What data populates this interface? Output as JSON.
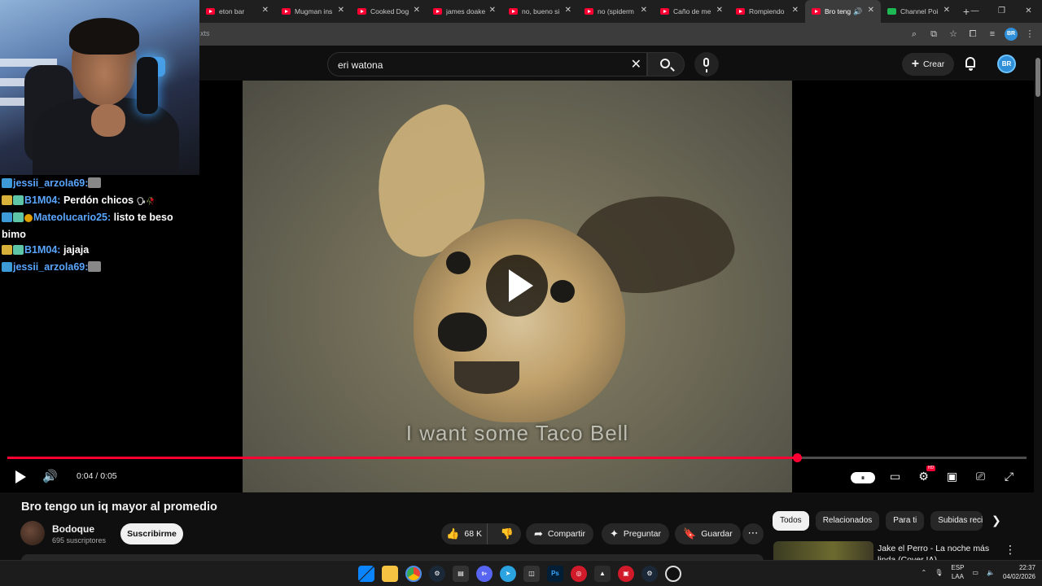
{
  "browser": {
    "tabs": [
      {
        "label": "eton bar",
        "favicon": "youtube-icon",
        "active": false
      },
      {
        "label": "Mugman ins",
        "favicon": "youtube-icon",
        "active": false
      },
      {
        "label": "Cooked Dog",
        "favicon": "youtube-icon",
        "active": false
      },
      {
        "label": "james doake",
        "favicon": "youtube-icon",
        "active": false
      },
      {
        "label": "no, bueno si",
        "favicon": "youtube-icon",
        "active": false
      },
      {
        "label": "no (spiderm",
        "favicon": "youtube-icon",
        "active": false
      },
      {
        "label": "Caño de me",
        "favicon": "youtube-icon",
        "active": false
      },
      {
        "label": "Rompiendo",
        "favicon": "youtube-icon",
        "active": false
      },
      {
        "label": "Bro teng",
        "favicon": "youtube-icon",
        "active": true
      },
      {
        "label": "Channel Poi",
        "favicon": "kick-icon",
        "active": false
      }
    ],
    "new_tab": "+",
    "close_glyph": "✕",
    "address_fragment": "xts",
    "window_controls": [
      "—",
      "❐",
      "✕"
    ],
    "profile_initials": "BR"
  },
  "youtube": {
    "search": {
      "value": "eri watona"
    },
    "create_label": "Crear",
    "avatar_initials": "BR"
  },
  "player": {
    "subtitle": "I want some Taco Bell",
    "time_display": "0:04 / 0:05",
    "progress_fraction": 0.775,
    "autoplay_glyph": "⏸",
    "hd_badge": "HD",
    "accent": "#ff0033"
  },
  "video": {
    "title": "Bro tengo un iq mayor al promedio",
    "channel": "Bodoque",
    "subscribers": "695 suscriptores",
    "subscribe_label": "Suscribirme",
    "likes": "68 K",
    "share_label": "Compartir",
    "ask_label": "Preguntar",
    "save_label": "Guardar"
  },
  "sidebar": {
    "chips": [
      "Todos",
      "Relacionados",
      "Para ti",
      "Subidas reci"
    ],
    "recommendation": {
      "title": "Jake el Perro - La noche más linda (Cover IA)"
    }
  },
  "chat": {
    "messages": [
      {
        "user": "jessii_arzola69:",
        "text": ""
      },
      {
        "user": "B1M04:",
        "text": "Perdón chicos"
      },
      {
        "user": "Mateolucario25:",
        "text": "listo te beso bimo"
      },
      {
        "user": "B1M04:",
        "text": "jajaja"
      },
      {
        "user": "jessii_arzola69:",
        "text": ""
      }
    ],
    "colors": {
      "blue": "#5aa6ff",
      "gold": "#d8b13a"
    }
  },
  "taskbar": {
    "apps": [
      "windows-icon",
      "file-explorer-icon",
      "chrome-icon",
      "steam-icon",
      "app-icon",
      "discord-icon",
      "telegram-icon",
      "app-icon",
      "photoshop-icon",
      "app-icon",
      "app-icon",
      "app-icon",
      "steam-icon",
      "obs-icon"
    ],
    "ps_label": "Ps",
    "discord_badge": "9+",
    "lang_top": "ESP",
    "lang_bottom": "LAA",
    "time": "22:37",
    "date": "04/02/2026"
  }
}
